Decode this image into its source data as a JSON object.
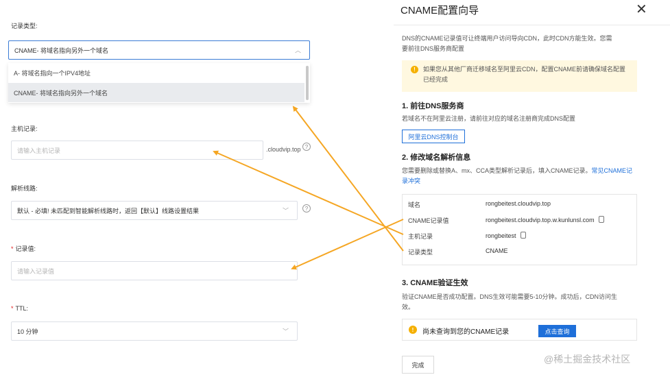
{
  "form": {
    "record_type_label": "记录类型:",
    "record_type_value": "CNAME- 将域名指向另外一个域名",
    "options": [
      "A- 将域名指向一个IPV4地址",
      "CNAME- 将域名指向另外一个域名"
    ],
    "host_label": "主机记录:",
    "host_placeholder": "请输入主机记录",
    "host_suffix": ".cloudvip.top",
    "line_label": "解析线路:",
    "line_value": "默认 - 必填! 未匹配到智能解析线路时，返回【默认】线路设置结果",
    "value_label": "记录值:",
    "value_placeholder": "请输入记录值",
    "ttl_label": "TTL:",
    "ttl_value": "10 分钟",
    "required_mark": "*",
    "help_glyph": "?"
  },
  "wizard": {
    "title": "CNAME配置向导",
    "close_glyph": "✕",
    "intro": [
      "DNS的CNAME记录值可让终端用户访问导向CDN，此时CDN方能生效。您需",
      "要前往DNS服务商配置"
    ],
    "tip": "如果您从其他厂商迁移域名至阿里云CDN，配置CNAME前请确保域名配置已经完成",
    "step1_title": "1. 前往DNS服务商",
    "step1_desc": "若域名不在阿里云注册，请前往对应的域名注册商完成DNS配置",
    "step1_button": "阿里云DNS控制台",
    "step2_title": "2. 修改域名解析信息",
    "step2_desc": "您需要删除或替换A、mx、CCA类型解析记录后，填入CNAME记录。",
    "step2_link": "常见CNAME记录冲突",
    "records": [
      {
        "key": "域名",
        "value": "rongbeitest.cloudvip.top"
      },
      {
        "key": "CNAME记录值",
        "value": "rongbeitest.cloudvip.top.w.kunlunsl.com"
      },
      {
        "key": "主机记录",
        "value": "rongbeitest"
      },
      {
        "key": "记录类型",
        "value": "CNAME"
      }
    ],
    "step3_title": "3. CNAME验证生效",
    "step3_desc": [
      "验证CNAME是否成功配置。DNS生效可能需要5-10分钟。成功后，CDN访问生",
      "效。"
    ],
    "status_text": "尚未查询到您的CNAME记录",
    "query_button": "点击查询",
    "done_button": "完成",
    "warn_glyph": "!"
  },
  "watermark": "@稀土掘金技术社区",
  "colors": {
    "arrow": "#f5a623",
    "primary": "#1e6fd9",
    "tip_bg": "#fff8e0",
    "warn": "#f5b000"
  }
}
